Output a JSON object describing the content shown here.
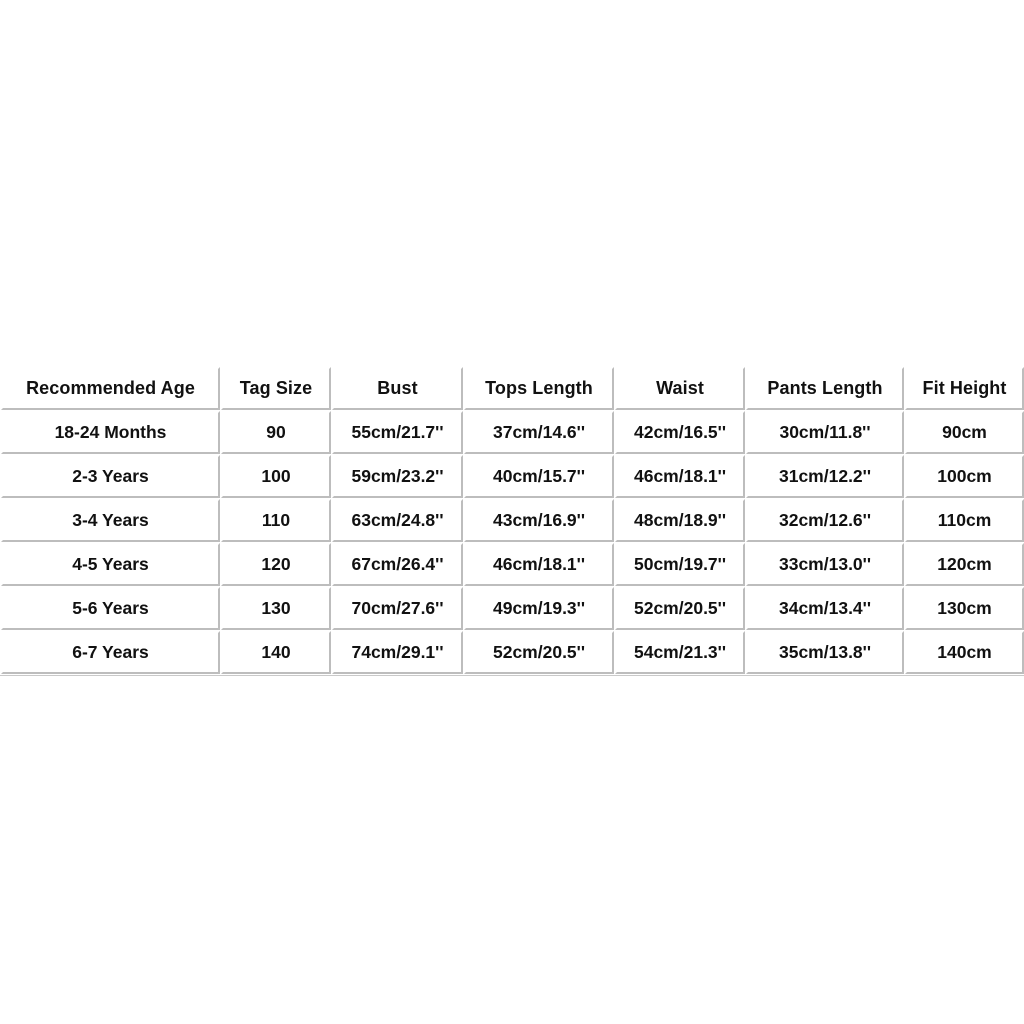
{
  "table": {
    "name": "childrens-clothing-size-chart",
    "columns": [
      "Recommended Age",
      "Tag Size",
      "Bust",
      "Tops Length",
      "Waist",
      "Pants Length",
      "Fit Height"
    ],
    "rows": [
      [
        "18-24 Months",
        "90",
        "55cm/21.7''",
        "37cm/14.6''",
        "42cm/16.5''",
        "30cm/11.8''",
        "90cm"
      ],
      [
        "2-3 Years",
        "100",
        "59cm/23.2''",
        "40cm/15.7''",
        "46cm/18.1''",
        "31cm/12.2''",
        "100cm"
      ],
      [
        "3-4 Years",
        "110",
        "63cm/24.8''",
        "43cm/16.9''",
        "48cm/18.9''",
        "32cm/12.6''",
        "110cm"
      ],
      [
        "4-5 Years",
        "120",
        "67cm/26.4''",
        "46cm/18.1''",
        "50cm/19.7''",
        "33cm/13.0''",
        "120cm"
      ],
      [
        "5-6 Years",
        "130",
        "70cm/27.6''",
        "49cm/19.3''",
        "52cm/20.5''",
        "34cm/13.4''",
        "130cm"
      ],
      [
        "6-7 Years",
        "140",
        "74cm/29.1''",
        "52cm/20.5''",
        "54cm/21.3''",
        "35cm/13.8''",
        "140cm"
      ]
    ]
  },
  "colors": {
    "background": "#ffffff",
    "text": "#111111",
    "cell_highlight": "#ffffff",
    "cell_shadow": "#bdbdbd",
    "table_border": "#c9c9c9"
  }
}
